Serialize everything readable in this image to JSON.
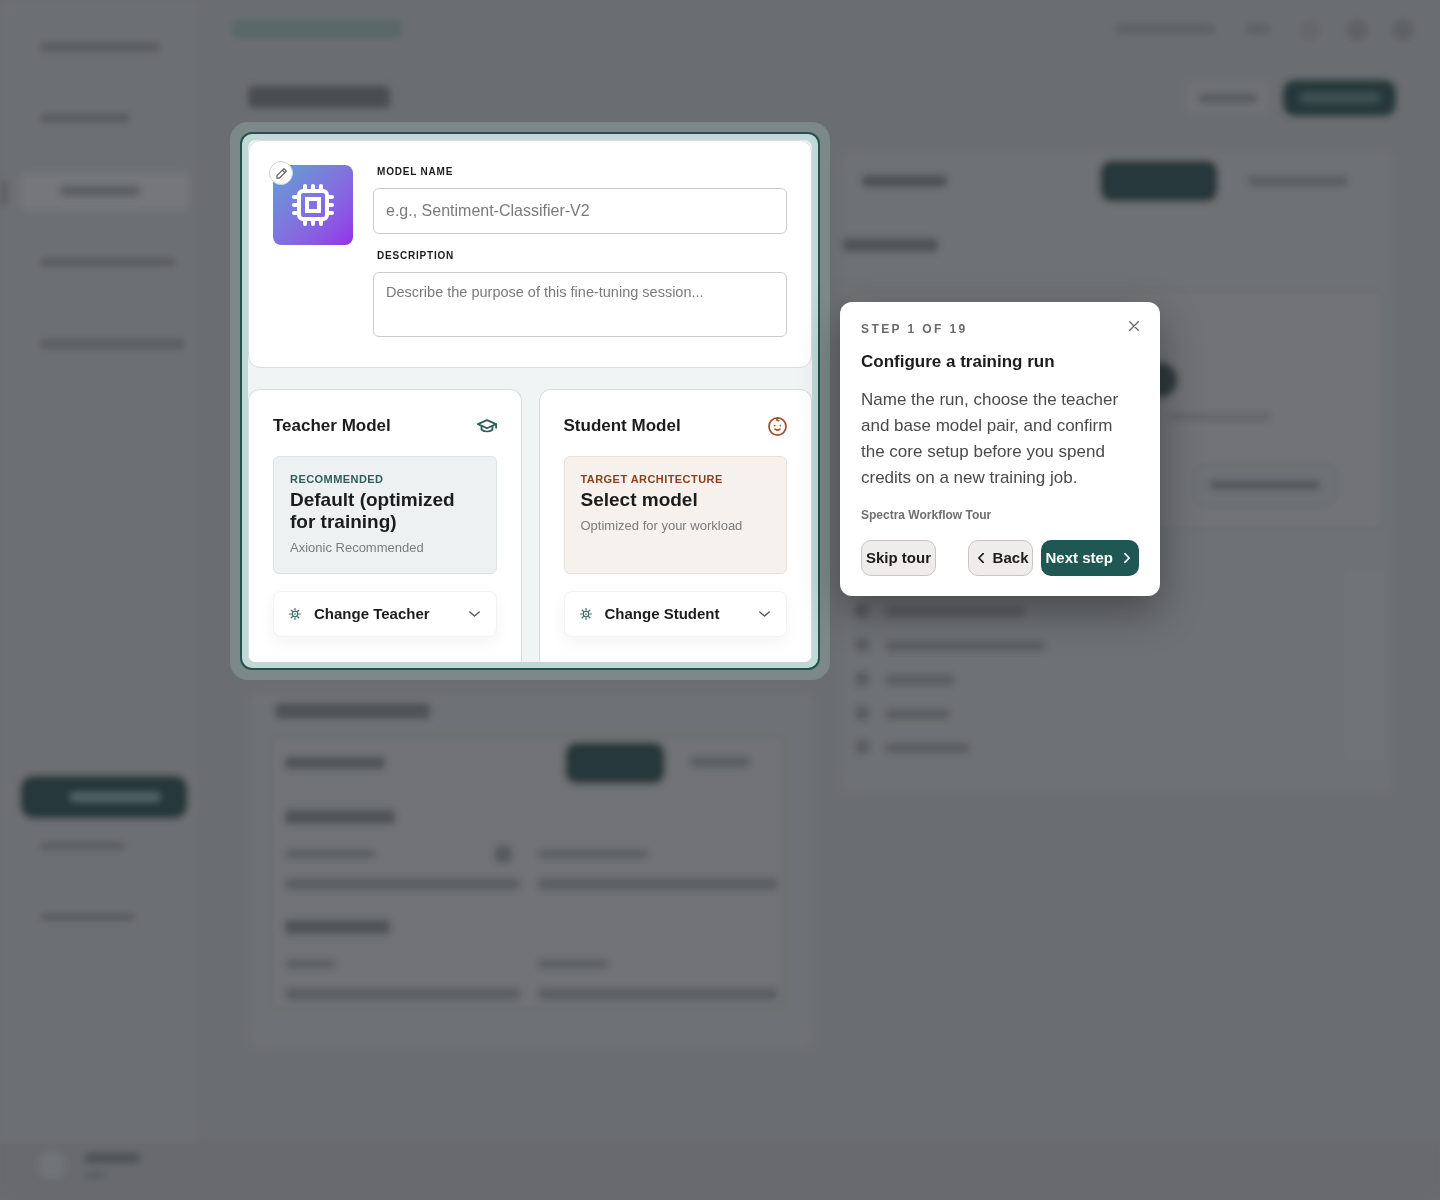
{
  "model_form": {
    "fields": [
      {
        "kind": "input",
        "label": "MODEL NAME",
        "placeholder": "e.g., Sentiment-Classifier-V2"
      },
      {
        "kind": "textarea",
        "label": "DESCRIPTION",
        "placeholder": "Describe the purpose of this fine-tuning session..."
      }
    ]
  },
  "model_cards": [
    {
      "kind": "teacher",
      "title": "Teacher Model",
      "tag": "RECOMMENDED",
      "model": "Default (optimized for training)",
      "note": "Axionic Recommended",
      "action": "Change Teacher"
    },
    {
      "kind": "student",
      "title": "Student Model",
      "tag": "TARGET ARCHITECTURE",
      "model": "Select model",
      "note": "Optimized for your workload",
      "action": "Change Student"
    }
  ],
  "tour": {
    "step": "STEP 1 OF 19",
    "title": "Configure a training run",
    "body": "Name the run, choose the teacher and base model pair, and confirm the core setup before you spend credits on a new training job.",
    "source": "Spectra Workflow Tour",
    "buttons": [
      {
        "kind": "skip",
        "label": "Skip tour"
      },
      {
        "kind": "back",
        "label": "Back"
      },
      {
        "kind": "next",
        "label": "Next step"
      }
    ]
  }
}
